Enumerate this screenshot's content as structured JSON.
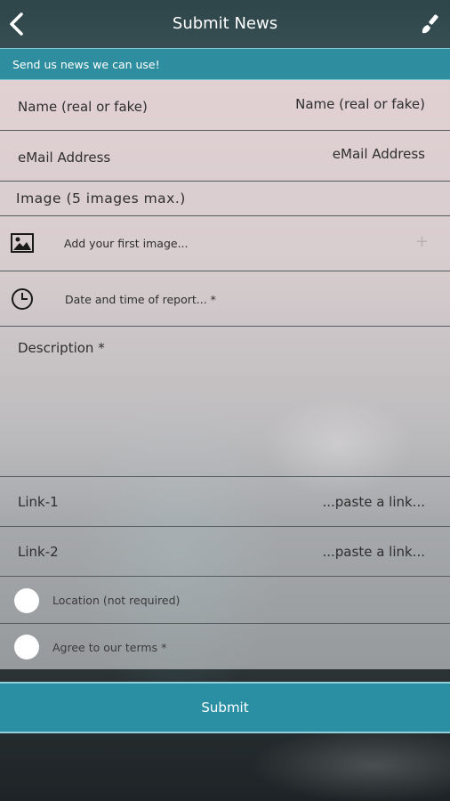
{
  "header": {
    "title": "Submit News",
    "back_icon": "chevron-left-icon",
    "action_icon": "paintbrush-icon"
  },
  "banner": {
    "text": "Send us news we can use!"
  },
  "form": {
    "name": {
      "label": "Name (real or fake)",
      "placeholder": "Name (real or fake)"
    },
    "email": {
      "label": "eMail Address",
      "placeholder": "eMail Address"
    },
    "image_section": {
      "label": "Image (5 images max.)"
    },
    "add_image": {
      "label": "Add your first image...",
      "add_symbol": "+"
    },
    "datetime": {
      "label": "Date and time of report... *"
    },
    "description": {
      "label": "Description *"
    },
    "link1": {
      "label": "Link-1",
      "placeholder": "...paste a link..."
    },
    "link2": {
      "label": "Link-2",
      "placeholder": "...paste a link..."
    },
    "location": {
      "label": "Location (not required)"
    },
    "terms": {
      "label": "Agree to our terms *"
    }
  },
  "submit": {
    "label": "Submit"
  },
  "colors": {
    "accent": "#2e8ea0",
    "banner_border": "#7fc8d4"
  }
}
